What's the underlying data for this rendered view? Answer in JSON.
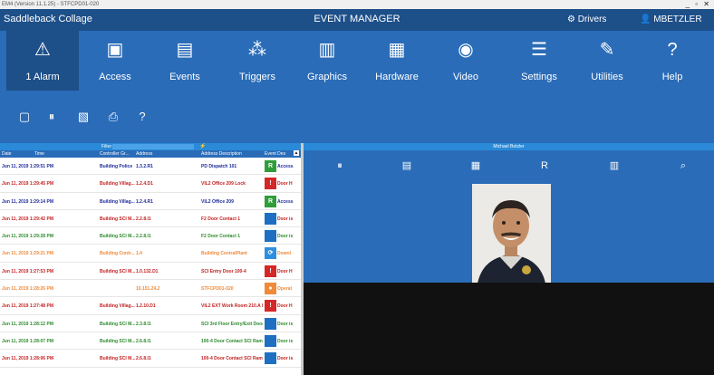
{
  "window": {
    "title": "EM4 (Version 11.1.25) - STFCPD01-020",
    "controls": "_ ▫ ✕"
  },
  "header": {
    "app_name": "Saddleback Collage",
    "center_title": "EVENT MANAGER",
    "drivers": "Drivers",
    "user": "MBETZLER"
  },
  "nav": [
    {
      "icon": "⚠",
      "label": "1 Alarm"
    },
    {
      "icon": "▣",
      "label": "Access"
    },
    {
      "icon": "▤",
      "label": "Events"
    },
    {
      "icon": "⁂",
      "label": "Triggers"
    },
    {
      "icon": "▥",
      "label": "Graphics"
    },
    {
      "icon": "▦",
      "label": "Hardware"
    },
    {
      "icon": "◉",
      "label": "Video"
    },
    {
      "icon": "☰",
      "label": "Settings"
    },
    {
      "icon": "✎",
      "label": "Utilities"
    },
    {
      "icon": "?",
      "label": "Help"
    }
  ],
  "toolbar": {
    "icons": [
      "▢",
      "⏸",
      "▧",
      "⎙",
      "?"
    ]
  },
  "events": {
    "filter_label": "Filter",
    "columns": [
      "Date",
      "Time",
      "Controller Gr...",
      "Address",
      "Address Description",
      "Event Des"
    ],
    "rows": [
      {
        "datetime": "Jun 11, 2019 1:29:51 PM",
        "controller": "Building Police",
        "address": "1.3.2.R1",
        "description": "PD Dispatch 101",
        "event": "Access",
        "color": "#1c2a9a",
        "icon": "R",
        "icon_bg": "#2f9e3a"
      },
      {
        "datetime": "Jun 11, 2019 1:29:45 PM",
        "controller": "Building Villag...",
        "address": "1.2.4.D1",
        "description": "VIL2 Office 209 Lock",
        "event": "Door H",
        "color": "#c21f1f",
        "icon": "!",
        "icon_bg": "#d42828"
      },
      {
        "datetime": "Jun 11, 2019 1:29:14 PM",
        "controller": "Building Villag...",
        "address": "1.2.4.R1",
        "description": "VIL2 Office 209",
        "event": "Access",
        "color": "#1c2a9a",
        "icon": "R",
        "icon_bg": "#2f9e3a"
      },
      {
        "datetime": "Jun 11, 2019 1:29:42 PM",
        "controller": "Building SCI M...",
        "address": "2.2.8.I1",
        "description": "F2 Door Contact 1",
        "event": "Door is",
        "color": "#c21f1f",
        "icon": " ",
        "icon_bg": "#1e6fc2"
      },
      {
        "datetime": "Jun 11, 2019 1:29:28 PM",
        "controller": "Building SCI M...",
        "address": "2.2.8.I1",
        "description": "F2 Door Contact 1",
        "event": "Door is",
        "color": "#2d8a2d",
        "icon": " ",
        "icon_bg": "#1e6fc2"
      },
      {
        "datetime": "Jun 11, 2019 1:29:21 PM",
        "controller": "Building Contr...",
        "address": "1.4",
        "description": "Building CentralPlant",
        "event": "Downl",
        "color": "#f08a3a",
        "icon": "⟳",
        "icon_bg": "#2e8fe0"
      },
      {
        "datetime": "Jun 11, 2019 1:27:53 PM",
        "controller": "Building SCI M...",
        "address": "1.0.132.D1",
        "description": "SCI Entry Door 100-4",
        "event": "Door H",
        "color": "#c21f1f",
        "icon": "!",
        "icon_bg": "#d42828"
      },
      {
        "datetime": "Jun 11, 2019 1:28:26 PM",
        "controller": "",
        "address": "10.151.24.2",
        "description": "STFCPD01-020",
        "event": "Operat",
        "color": "#f08a3a",
        "icon": "●",
        "icon_bg": "#f08a3a"
      },
      {
        "datetime": "Jun 11, 2019 1:27:48 PM",
        "controller": "Building Villag...",
        "address": "1.2.10.D1",
        "description": "VIL2 EXT Work Room 210.A I...",
        "event": "Door H",
        "color": "#c21f1f",
        "icon": "!",
        "icon_bg": "#d42828"
      },
      {
        "datetime": "Jun 11, 2019 1:28:12 PM",
        "controller": "Building SCI M...",
        "address": "2.3.8.I1",
        "description": "SCI 3rd Floor Entry/Exit Door ...",
        "event": "Door is",
        "color": "#2d8a2d",
        "icon": " ",
        "icon_bg": "#1e6fc2"
      },
      {
        "datetime": "Jun 11, 2019 1:28:07 PM",
        "controller": "Building SCI M...",
        "address": "2.6.8.I1",
        "description": "100-4 Door Contact SCI Ram...",
        "event": "Door is",
        "color": "#2d8a2d",
        "icon": " ",
        "icon_bg": "#1e6fc2"
      },
      {
        "datetime": "Jun 11, 2019 1:28:06 PM",
        "controller": "Building SCI M...",
        "address": "2.6.8.I1",
        "description": "100-4 Door Contact SCI Ram...",
        "event": "Door is",
        "color": "#c21f1f",
        "icon": " ",
        "icon_bg": "#1e6fc2"
      }
    ]
  },
  "detail": {
    "person_name": "Michael Betzler",
    "toolbar_icons": [
      "⏸",
      "▤",
      "▦",
      "R",
      "▥",
      "⌕"
    ]
  }
}
